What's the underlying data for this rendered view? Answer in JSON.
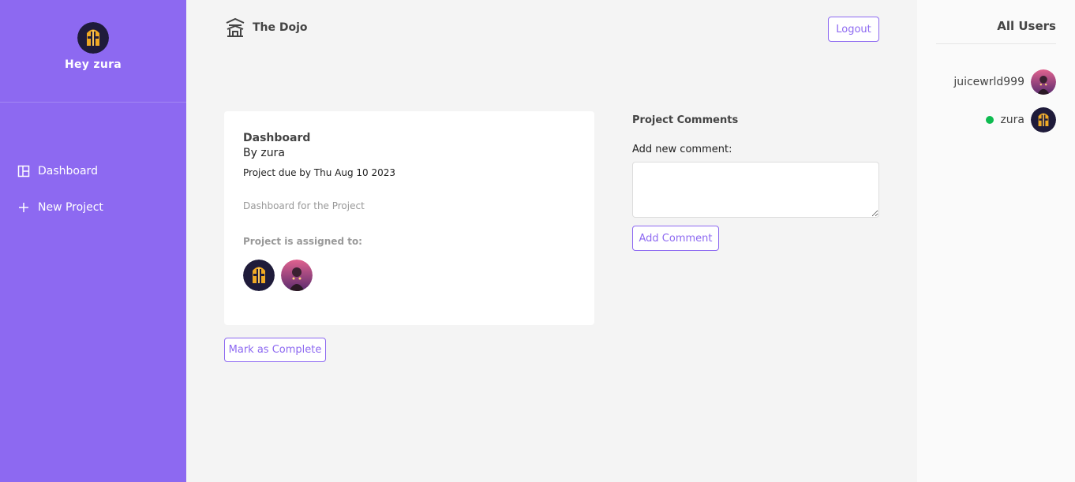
{
  "sidebar": {
    "greeting": "Hey zura",
    "avatar_icon": "knight-helmet-icon",
    "items": [
      {
        "label": "Dashboard",
        "icon": "dashboard-icon"
      },
      {
        "label": "New Project",
        "icon": "plus-icon"
      }
    ]
  },
  "header": {
    "brand": "The Dojo",
    "brand_icon": "temple-icon",
    "logout": "Logout"
  },
  "project": {
    "name": "Dashboard",
    "by": "By zura",
    "due": "Project due by Thu Aug 10 2023",
    "details": "Dashboard for the Project",
    "assigned_label": "Project is assigned to:",
    "complete_button": "Mark as Complete"
  },
  "comments": {
    "title": "Project Comments",
    "add_label": "Add new comment:",
    "add_button": "Add Comment"
  },
  "users": {
    "title": "All Users",
    "list": [
      {
        "name": "juicewrld999",
        "online": false
      },
      {
        "name": "zura",
        "online": true
      }
    ]
  },
  "colors": {
    "primary": "#8d69f1",
    "online": "#0ebb50"
  }
}
